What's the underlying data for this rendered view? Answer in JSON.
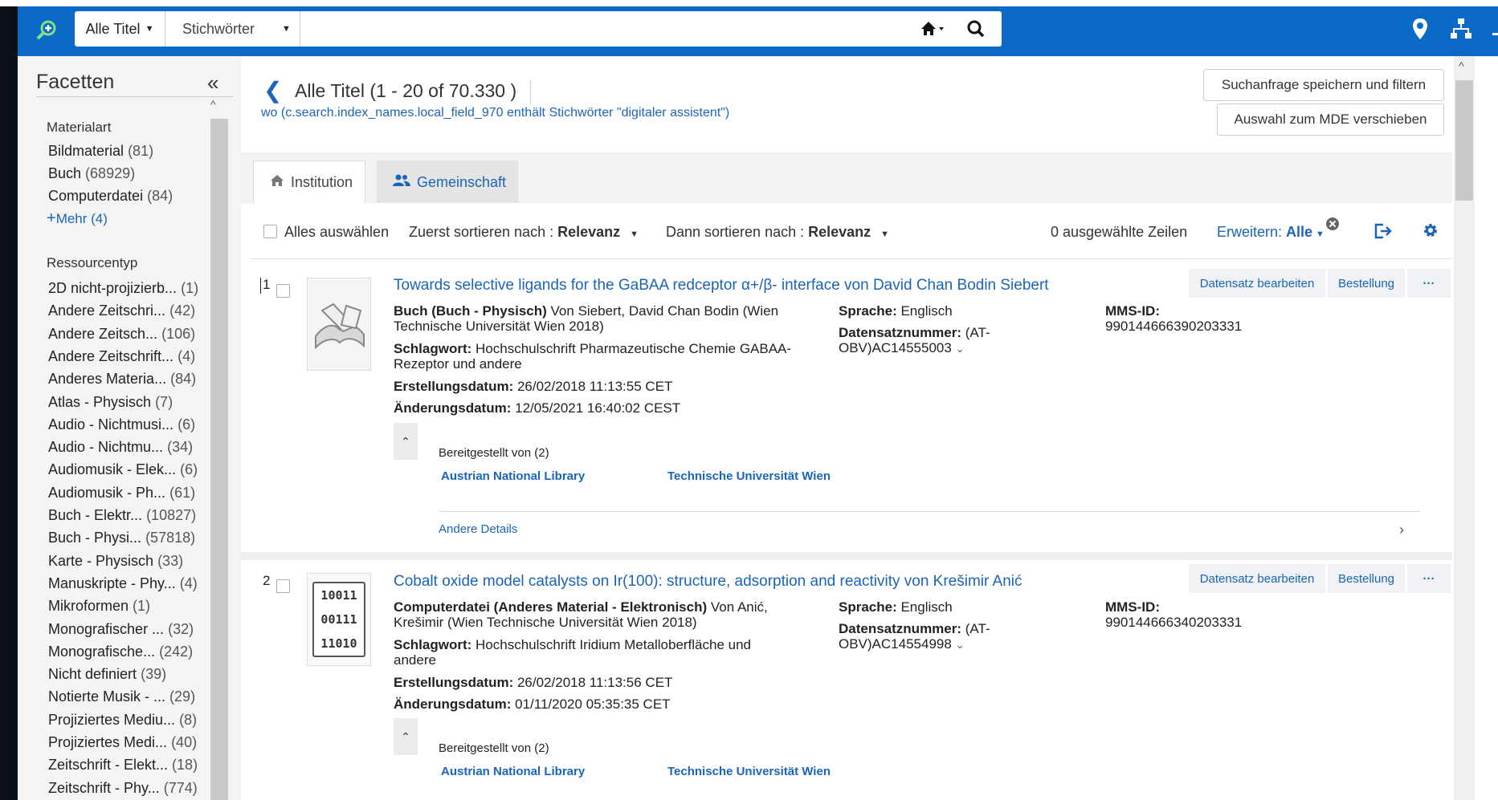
{
  "topbar": {
    "scope_label": "Alle Titel",
    "field_label": "Stichwörter",
    "search_value": ""
  },
  "facets": {
    "title": "Facetten",
    "groups": [
      {
        "name": "Materialart",
        "items": [
          {
            "label": "Bildmaterial",
            "count": "(81)"
          },
          {
            "label": "Buch",
            "count": "(68929)"
          },
          {
            "label": "Computerdatei",
            "count": "(84)"
          }
        ],
        "more": "Mehr (4)"
      },
      {
        "name": "Ressourcentyp",
        "items": [
          {
            "label": "2D nicht-projizierb...",
            "count": "(1)"
          },
          {
            "label": "Andere Zeitschri...",
            "count": "(42)"
          },
          {
            "label": "Andere Zeitsch...",
            "count": "(106)"
          },
          {
            "label": "Andere Zeitschrift...",
            "count": "(4)"
          },
          {
            "label": "Anderes Materia...",
            "count": "(84)"
          },
          {
            "label": "Atlas - Physisch",
            "count": "(7)"
          },
          {
            "label": "Audio - Nichtmusi...",
            "count": "(6)"
          },
          {
            "label": "Audio - Nichtmu...",
            "count": "(34)"
          },
          {
            "label": "Audiomusik - Elek...",
            "count": "(6)"
          },
          {
            "label": "Audiomusik - Ph...",
            "count": "(61)"
          },
          {
            "label": "Buch - Elektr...",
            "count": "(10827)"
          },
          {
            "label": "Buch - Physi...",
            "count": "(57818)"
          },
          {
            "label": "Karte - Physisch",
            "count": "(33)"
          },
          {
            "label": "Manuskripte - Phy...",
            "count": "(4)"
          },
          {
            "label": "Mikroformen",
            "count": "(1)"
          },
          {
            "label": "Monografischer ...",
            "count": "(32)"
          },
          {
            "label": "Monografische...",
            "count": "(242)"
          },
          {
            "label": "Nicht definiert",
            "count": "(39)"
          },
          {
            "label": "Notierte Musik - ...",
            "count": "(29)"
          },
          {
            "label": "Projiziertes Mediu...",
            "count": "(8)"
          },
          {
            "label": "Projiziertes Medi...",
            "count": "(40)"
          },
          {
            "label": "Zeitschrift - Elekt...",
            "count": "(18)"
          },
          {
            "label": "Zeitschrift - Phy...",
            "count": "(774)"
          }
        ]
      }
    ]
  },
  "main": {
    "title": "Alle Titel (1 - 20 of 70.330 )",
    "query": "wo (c.search.index_names.local_field_970 enthält Stichwörter \"digitaler assistent\")",
    "save_button": "Suchanfrage speichern und filtern",
    "mde_button": "Auswahl zum MDE verschieben",
    "tabs": [
      "Institution",
      "Gemeinschaft"
    ],
    "toolbar": {
      "select_all": "Alles auswählen",
      "sort1_prefix": "Zuerst sortieren nach : ",
      "sort1_value": "Relevanz",
      "sort2_prefix": "Dann sortieren nach : ",
      "sort2_value": "Relevanz",
      "selected_rows": "0 ausgewählte Zeilen",
      "expand_prefix": "Erweitern: ",
      "expand_value": "Alle"
    }
  },
  "records": [
    {
      "num": "1",
      "title": "Towards selective ligands for the GaBAA redceptor α+/β- interface von David Chan Bodin Siebert",
      "type_bold": "Buch (Buch - Physisch)",
      "type_rest": " Von Siebert, David Chan Bodin (Wien",
      "type_line2": "Technische Universität Wien 2018)",
      "subject_label": "Schlagwort:",
      "subject_rest": " Hochschulschrift Pharmazeutische Chemie GABAA-",
      "subject_line2": "Rezeptor und andere",
      "created_label": "Erstellungsdatum:",
      "created": " 26/02/2018 11:13:55 CET",
      "modified_label": "Änderungsdatum:",
      "modified": " 12/05/2021 16:40:02 CEST",
      "lang_label": "Sprache:",
      "lang": " Englisch",
      "recno_label": "Datensatznummer:",
      "recno_rest": " (AT-",
      "recno_line2": "OBV)AC14555003",
      "mms_label": "MMS-ID:",
      "mms": "990144666390203331",
      "edit_btn": "Datensatz bearbeiten",
      "order_btn": "Bestellung",
      "more_btn": "···",
      "provided_by": "Bereitgestellt von (2)",
      "libs": [
        "Austrian National Library",
        "Technische Universität Wien"
      ],
      "other_details": "Andere Details"
    },
    {
      "num": "2",
      "title": "Cobalt oxide model catalysts on Ir(100): structure, adsorption and reactivity von Krešimir Anić",
      "type_bold": "Computerdatei (Anderes Material - Elektronisch)",
      "type_rest": " Von Anić,",
      "type_line2": "Krešimir (Wien Technische Universität Wien 2018)",
      "subject_label": "Schlagwort:",
      "subject_rest": " Hochschulschrift Iridium Metalloberfläche und",
      "subject_line2": "andere",
      "created_label": "Erstellungsdatum:",
      "created": " 26/02/2018 11:13:56 CET",
      "modified_label": "Änderungsdatum:",
      "modified": " 01/11/2020 05:35:35 CET",
      "lang_label": "Sprache:",
      "lang": " Englisch",
      "recno_label": "Datensatznummer:",
      "recno_rest": " (AT-",
      "recno_line2": "OBV)AC14554998",
      "mms_label": "MMS-ID:",
      "mms": "990144666340203331",
      "edit_btn": "Datensatz bearbeiten",
      "order_btn": "Bestellung",
      "more_btn": "···",
      "provided_by": "Bereitgestellt von (2)",
      "libs": [
        "Austrian National Library",
        "Technische Universität Wien"
      ],
      "thumb_bits": [
        "10011",
        "00111",
        "11010"
      ]
    }
  ],
  "colors": {
    "topbar": "#0c6ac7",
    "link": "#1a65b7"
  }
}
